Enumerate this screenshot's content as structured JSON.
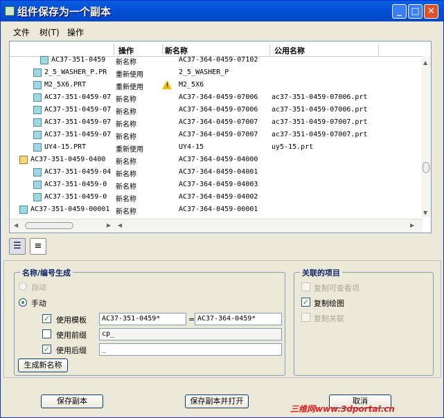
{
  "window": {
    "title": "组件保存为一个副本"
  },
  "menu": {
    "items": [
      "文件",
      "树(T)",
      "操作"
    ]
  },
  "tree": {
    "headers": {
      "op": "操作",
      "new_name": "新名称",
      "public_name": "公用名称"
    },
    "rows": [
      {
        "name": "AC37-351-0459",
        "op": "新名称",
        "new_name": "AC37-364-0459-07102",
        "public_name": "",
        "indent": 4,
        "icon": "part"
      },
      {
        "name": "2_5_WASHER_P.PR",
        "op": "重新使用",
        "new_name": "2_5_WASHER_P",
        "public_name": "",
        "indent": 3,
        "icon": "part"
      },
      {
        "name": "M2_5X6.PRT",
        "op": "重新使用",
        "new_name": "M2_5X6",
        "public_name": "",
        "indent": 3,
        "icon": "part",
        "warn": true
      },
      {
        "name": "AC37-351-0459-07",
        "op": "新名称",
        "new_name": "AC37-364-0459-07006",
        "public_name": "ac37-351-0459-07006.prt",
        "indent": 3,
        "icon": "part"
      },
      {
        "name": "AC37-351-0459-07",
        "op": "新名称",
        "new_name": "AC37-364-0459-07006",
        "public_name": "ac37-351-0459-07006.prt",
        "indent": 3,
        "icon": "part"
      },
      {
        "name": "AC37-351-0459-07",
        "op": "新名称",
        "new_name": "AC37-364-0459-07007",
        "public_name": "ac37-351-0459-07007.prt",
        "indent": 3,
        "icon": "part"
      },
      {
        "name": "AC37-351-0459-07",
        "op": "新名称",
        "new_name": "AC37-364-0459-07007",
        "public_name": "ac37-351-0459-07007.prt",
        "indent": 3,
        "icon": "part"
      },
      {
        "name": "UY4-15.PRT",
        "op": "重新使用",
        "new_name": "UY4-15",
        "public_name": "uy5-15.prt",
        "indent": 3,
        "icon": "part"
      },
      {
        "name": "AC37-351-0459-0400",
        "op": "新名称",
        "new_name": "AC37-364-0459-04000",
        "public_name": "",
        "indent": 1,
        "icon": "asm"
      },
      {
        "name": "AC37-351-0459-04",
        "op": "新名称",
        "new_name": "AC37-364-0459-04001",
        "public_name": "",
        "indent": 3,
        "icon": "part"
      },
      {
        "name": "AC37-351-0459-0",
        "op": "新名称",
        "new_name": "AC37-364-0459-04003",
        "public_name": "",
        "indent": 3,
        "icon": "part"
      },
      {
        "name": "AC37-351-0459-0",
        "op": "新名称",
        "new_name": "AC37-364-0459-04002",
        "public_name": "",
        "indent": 3,
        "icon": "part"
      },
      {
        "name": "AC37-351-0459-00001",
        "op": "新名称",
        "new_name": "AC37-364-0459-00001",
        "public_name": "",
        "indent": 1,
        "icon": "part"
      }
    ]
  },
  "naming": {
    "legend": "名称/编号生成",
    "auto_label": "自动",
    "manual_label": "手动",
    "use_template_label": "使用模板",
    "template_from": "AC37-351-0459*",
    "equals": "=",
    "template_to": "AC37-364-0459*",
    "use_prefix_label": "使用前缀",
    "prefix_value": "cp_",
    "use_suffix_label": "使用后缀",
    "suffix_value": "_",
    "generate_button": "生成新名称"
  },
  "related": {
    "legend": "关联的项目",
    "copy_views": "复制可查看项",
    "copy_drawing": "复制绘图",
    "copy_relations": "复制关联"
  },
  "footer": {
    "save_copy": "保存副本",
    "save_and_open": "保存副本并打开",
    "cancel": "取消"
  },
  "watermark": "三维网www.3dportal.cn"
}
